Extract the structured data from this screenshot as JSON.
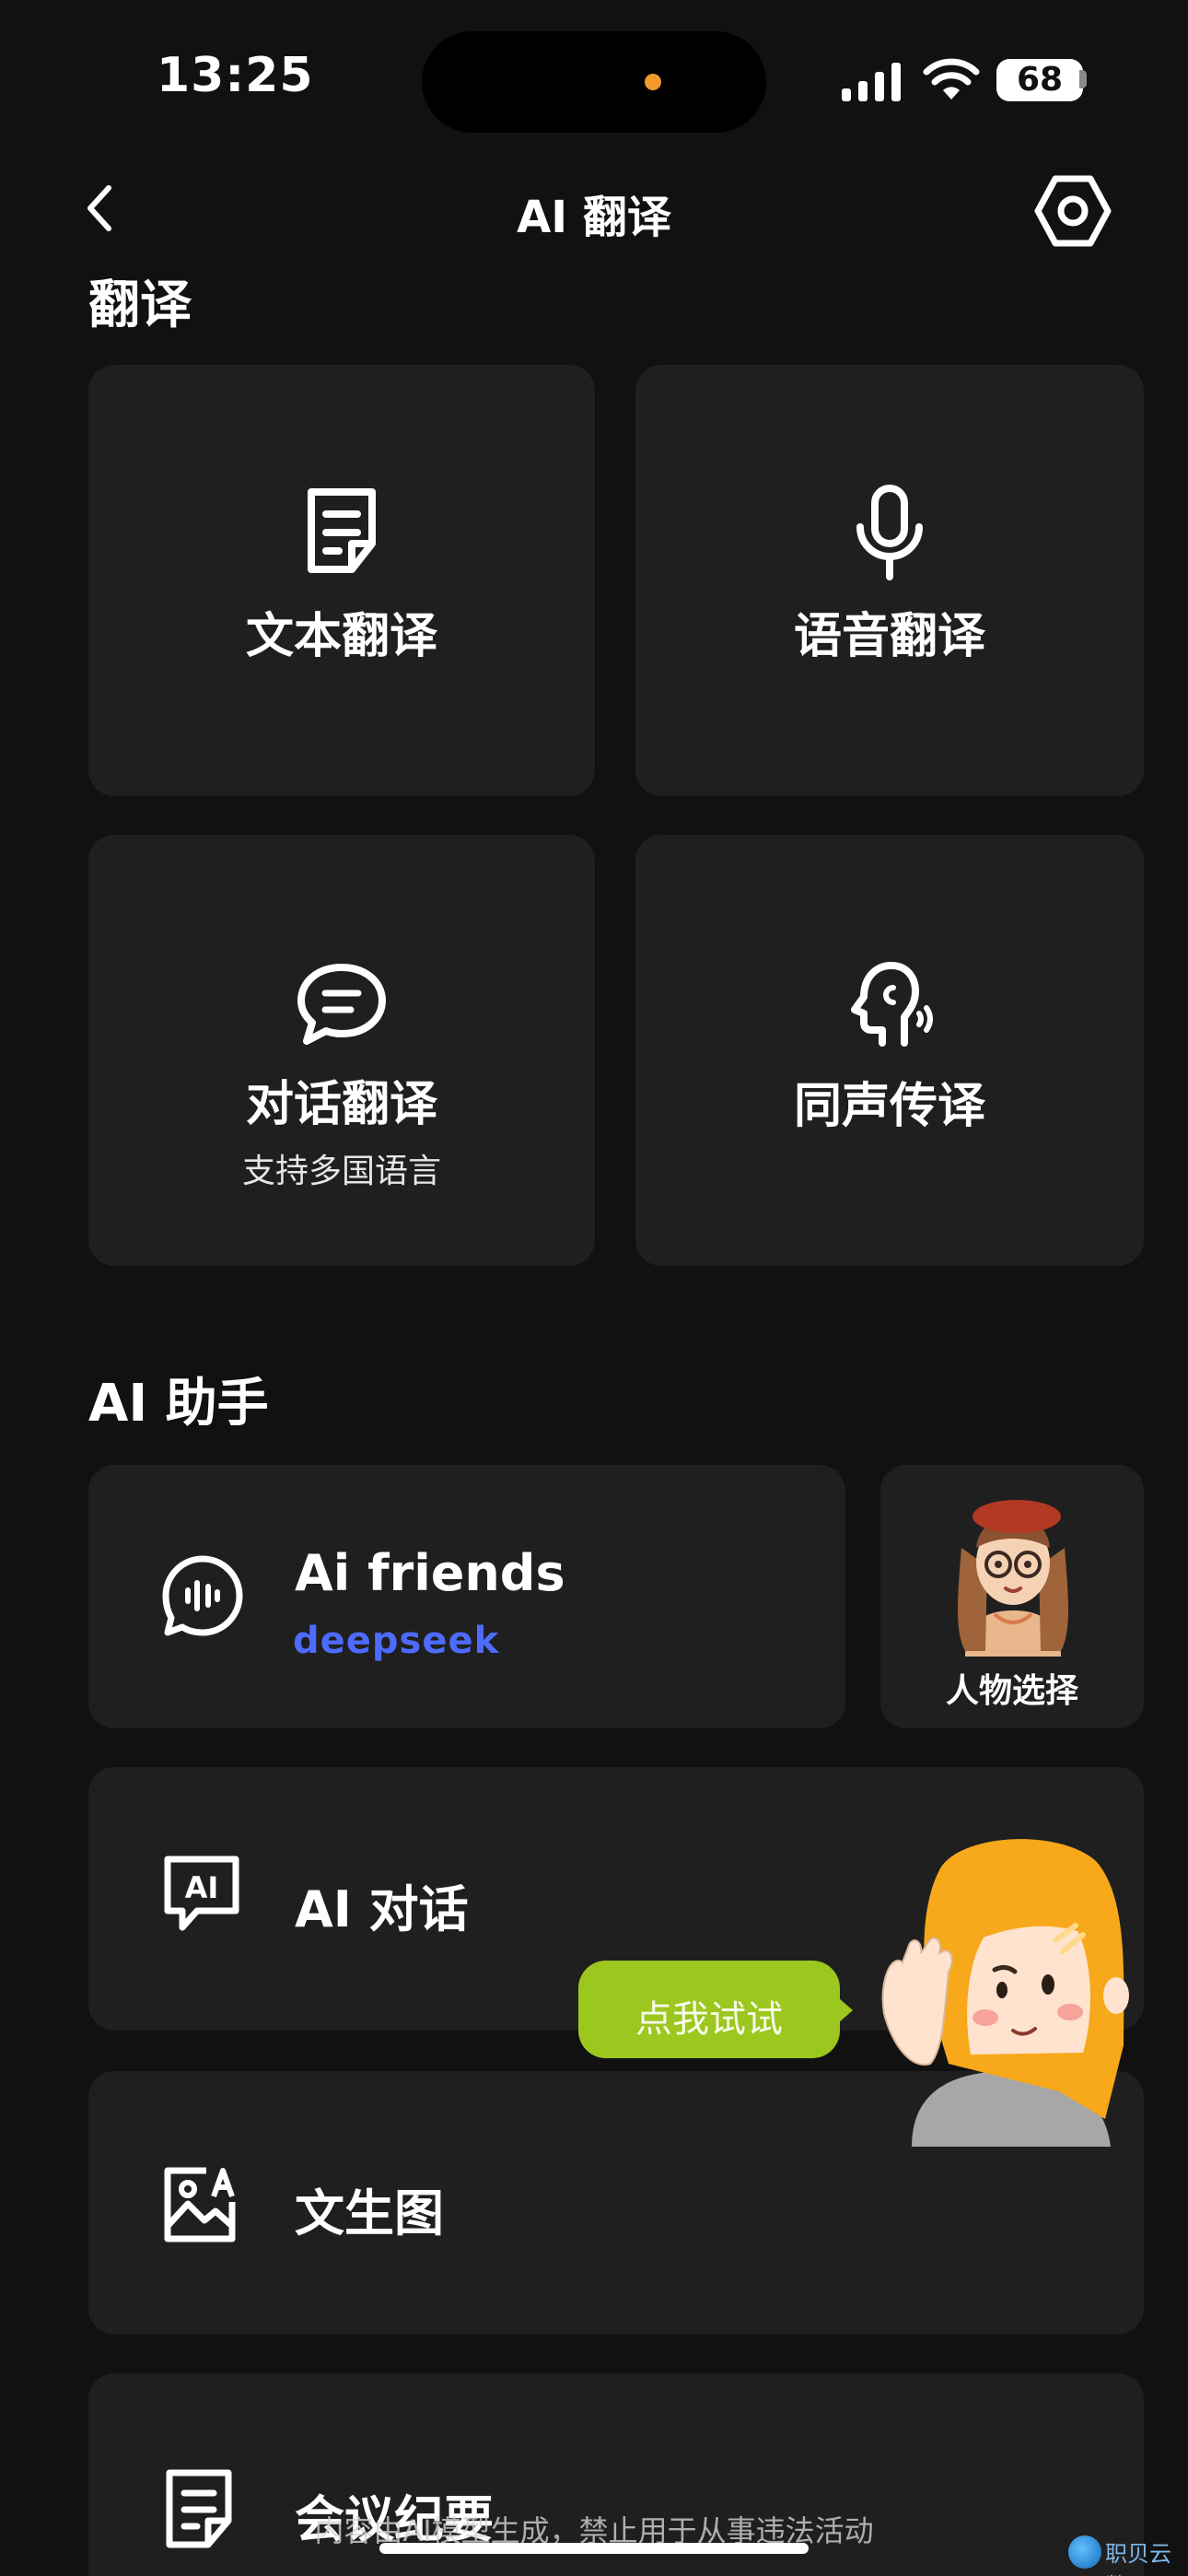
{
  "status": {
    "time": "13:25",
    "battery": "68"
  },
  "header": {
    "title": "AI 翻译"
  },
  "translate": {
    "section_title": "翻译",
    "tiles": [
      {
        "label": "文本翻译",
        "icon": "document-icon"
      },
      {
        "label": "语音翻译",
        "icon": "microphone-icon"
      },
      {
        "label": "对话翻译",
        "sub": "支持多国语言",
        "icon": "chat-bubble-icon"
      },
      {
        "label": "同声传译",
        "icon": "speaking-head-icon"
      }
    ]
  },
  "assistant": {
    "section_title": "AI 助手",
    "ai_friends": {
      "label": "Ai friends",
      "brand": "deepseek"
    },
    "character_select": {
      "label": "人物选择"
    },
    "rows": [
      {
        "label": "AI 对话",
        "icon": "ai-chat-icon"
      },
      {
        "label": "文生图",
        "icon": "image-icon"
      },
      {
        "label": "会议纪要",
        "icon": "document-icon"
      }
    ],
    "try_bubble": "点我试试"
  },
  "footer": {
    "disclaimer": "内容由AI模型生成，禁止用于从事违法活动",
    "watermark": "职贝云数"
  },
  "colors": {
    "background": "#111111",
    "card": "#1f1f1f",
    "deepseek_blue": "#4d6bfe",
    "bubble_green": "#9cc71f"
  }
}
